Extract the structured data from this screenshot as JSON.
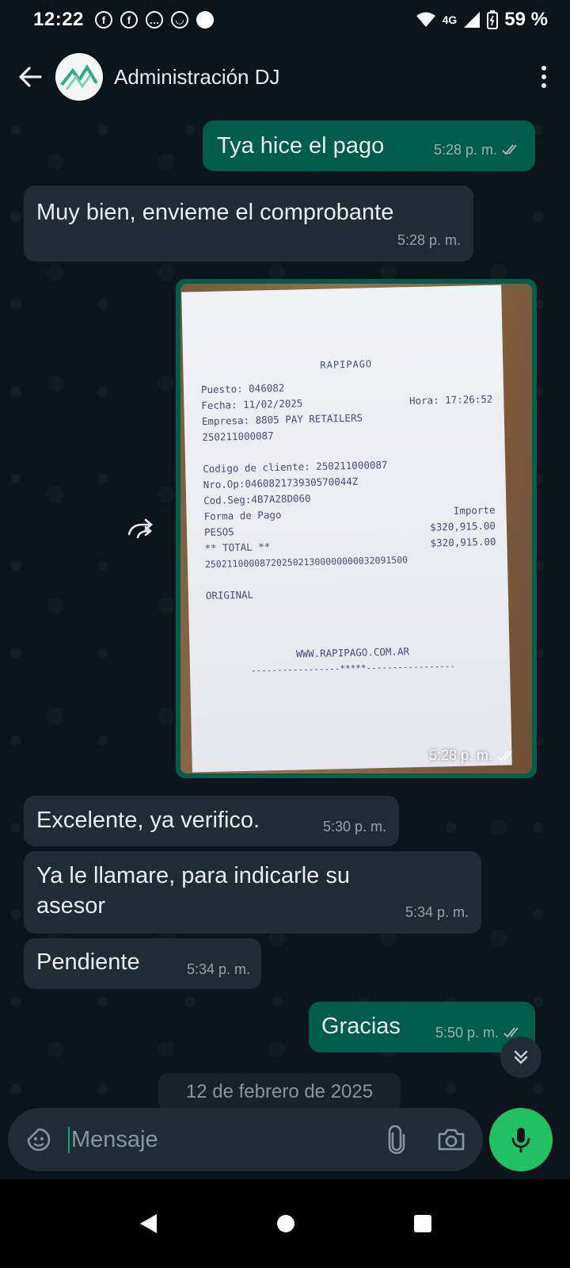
{
  "status_bar": {
    "time": "12:22",
    "network": "4G",
    "battery": "59 %"
  },
  "header": {
    "contact_name": "Administración DJ"
  },
  "messages": [
    {
      "direction": "out",
      "text": "Tya hice el pago",
      "time": "5:28 p. m."
    },
    {
      "direction": "in",
      "text": "Muy bien, envieme el comprobante",
      "time": "5:28 p. m."
    },
    {
      "direction": "out",
      "type": "image",
      "time": "5:28 p. m."
    },
    {
      "direction": "in",
      "text": "Excelente, ya verifico.",
      "time": "5:30 p. m."
    },
    {
      "direction": "in",
      "text": "Ya le llamare, para indicarle su asesor",
      "time": "5:34 p. m."
    },
    {
      "direction": "in",
      "text": "Pendiente",
      "time": "5:34 p. m."
    },
    {
      "direction": "out",
      "text": "Gracias",
      "time": "5:50 p. m."
    }
  ],
  "receipt": {
    "header": "RAPIPAGO",
    "puesto": "Puesto: 046082",
    "fecha": "Fecha: 11/02/2025",
    "hora": "Hora: 17:26:52",
    "empresa": "Empresa: 8805 PAY RETAILERS",
    "empresa_code": "250211000087",
    "codigo_cliente": "Codigo de cliente: 250211000087",
    "nro_op": "Nro.Op:046082173930570044Z",
    "cod_seg": "Cod.Seg:4B7A28D060",
    "forma_pago": "Forma de Pago",
    "importe": "Importe",
    "pesos_label": "PESOS",
    "pesos_value": "$320,915.00",
    "total_label": "** TOTAL **",
    "total_value": "$320,915.00",
    "barcode_number": "2502110000872025021300000000032091500",
    "original": "ORIGINAL",
    "website": "WWW.RAPIPAGO.COM.AR",
    "footer": "-----------------*****-----------------"
  },
  "date_divider": "12 de febrero de 2025",
  "input": {
    "placeholder": "Mensaje"
  },
  "colors": {
    "outgoing": "#005c4b",
    "incoming": "#202c33",
    "accent": "#21c063",
    "background": "#0b141a"
  }
}
